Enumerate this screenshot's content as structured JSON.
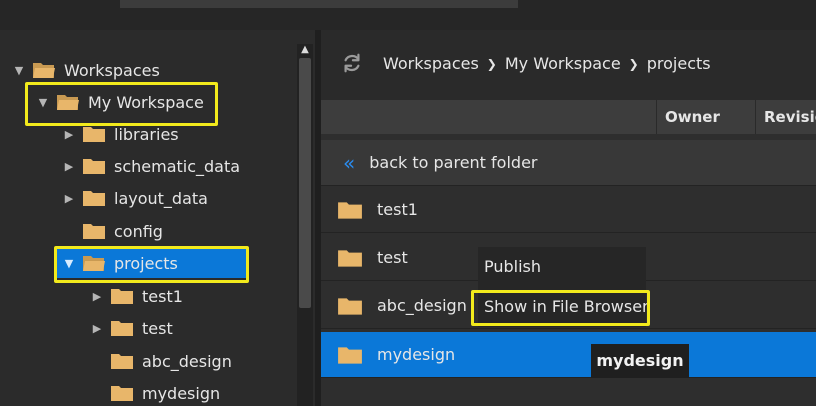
{
  "colors": {
    "accent": "#0b78d8",
    "folder": "#e8b66a",
    "highlight": "#f2ea1c",
    "chevron": "#2a8cf0"
  },
  "tree": {
    "items": [
      {
        "label": "Workspaces",
        "state": "expanded",
        "icon": "folder-open-icon"
      },
      {
        "label": "My Workspace",
        "state": "expanded",
        "icon": "folder-open-icon"
      },
      {
        "label": "libraries",
        "state": "collapsed",
        "icon": "folder-icon"
      },
      {
        "label": "schematic_data",
        "state": "collapsed",
        "icon": "folder-icon"
      },
      {
        "label": "layout_data",
        "state": "collapsed",
        "icon": "folder-icon"
      },
      {
        "label": "config",
        "state": "leaf",
        "icon": "folder-icon"
      },
      {
        "label": "projects",
        "state": "expanded",
        "icon": "folder-open-icon",
        "selected": true
      },
      {
        "label": "test1",
        "state": "collapsed",
        "icon": "folder-icon"
      },
      {
        "label": "test",
        "state": "collapsed",
        "icon": "folder-icon"
      },
      {
        "label": "abc_design",
        "state": "leaf",
        "icon": "folder-icon"
      },
      {
        "label": "mydesign",
        "state": "leaf",
        "icon": "folder-icon"
      }
    ]
  },
  "breadcrumb": {
    "items": [
      "Workspaces",
      "My Workspace",
      "projects"
    ]
  },
  "columns": [
    "Owner",
    "Revisio"
  ],
  "back_row": {
    "label": "back to parent folder"
  },
  "files": [
    {
      "name": "test1"
    },
    {
      "name": "test"
    },
    {
      "name": "abc_design"
    },
    {
      "name": "mydesign",
      "selected": true
    }
  ],
  "context_menu": {
    "items": [
      "Publish",
      "Show in File Browser"
    ]
  },
  "tooltip": {
    "text": "mydesign"
  }
}
